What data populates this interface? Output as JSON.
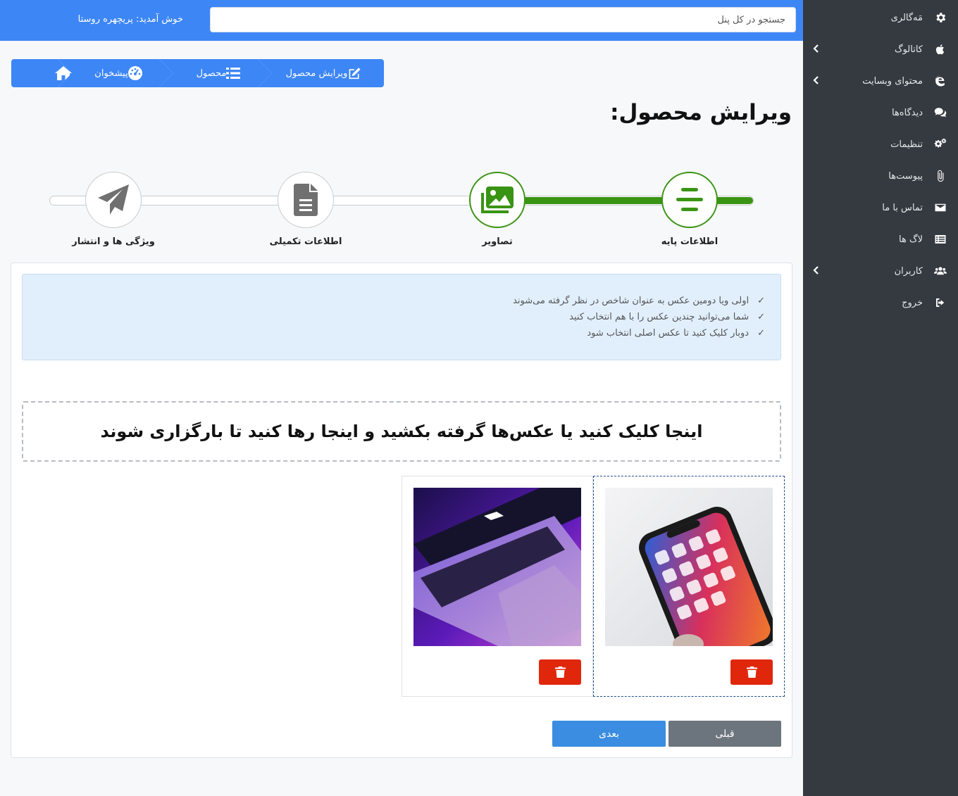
{
  "header": {
    "search_placeholder": "جستجو در کل پنل",
    "welcome": "خوش آمدید: پریچهره روستا"
  },
  "breadcrumb": {
    "items": [
      {
        "label": "ویرایش محصول",
        "icon": "edit-icon"
      },
      {
        "label": "محصول",
        "icon": "list-icon"
      },
      {
        "label": "پیشخوان",
        "icon": "dashboard-icon"
      },
      {
        "label": "",
        "icon": "home-icon"
      }
    ]
  },
  "page_title": "ویرایش محصول:",
  "stepper": {
    "steps": [
      {
        "label": "اطلاعات پایه",
        "icon": "align-center-icon",
        "done": true
      },
      {
        "label": "تصاویر",
        "icon": "images-icon",
        "done": true
      },
      {
        "label": "اطلاعات تکمیلی",
        "icon": "document-icon",
        "done": false
      },
      {
        "label": "ویژگی ها و انتشار",
        "icon": "paper-plane-icon",
        "done": false
      }
    ],
    "colors": {
      "done": "#3a9414",
      "pending": "#707070"
    }
  },
  "info": {
    "check": "✓",
    "tips": [
      "اولی ویا دومین عکس به عنوان شاخص در نظر گرفته می‌شوند",
      "شما می‌توانید چندین عکس را با هم انتخاب کنید",
      "دوبار کلیک کنید تا عکس اصلی انتخاب شود"
    ]
  },
  "dropzone": {
    "text": "اینجا کلیک کنید یا عکس‌ها گرفته بکشید و اینجا رها کنید تا بارگزاری شوند"
  },
  "images": [
    {
      "subject": "smartphone",
      "selected": true
    },
    {
      "subject": "laptop",
      "selected": false
    }
  ],
  "buttons": {
    "prev": "قبلی",
    "next": "بعدی"
  },
  "sidebar": {
    "items": [
      {
        "label": "مَه‌گالری",
        "icon": "gear-icon",
        "has_children": false
      },
      {
        "label": "کاتالوگ",
        "icon": "apple-icon",
        "has_children": true
      },
      {
        "label": "محتوای وبسایت",
        "icon": "edge-icon",
        "has_children": true
      },
      {
        "label": "دیدگاه‌ها",
        "icon": "comments-icon",
        "has_children": false
      },
      {
        "label": "تنظیمات",
        "icon": "cogs-icon",
        "has_children": false
      },
      {
        "label": "پیوست‌ها",
        "icon": "paperclip-icon",
        "has_children": false
      },
      {
        "label": "تماس با ما",
        "icon": "envelope-icon",
        "has_children": false
      },
      {
        "label": "لاگ ها",
        "icon": "list-alt-icon",
        "has_children": false
      },
      {
        "label": "کاربران",
        "icon": "users-icon",
        "has_children": true
      },
      {
        "label": "خروج",
        "icon": "sign-out-icon",
        "has_children": false
      }
    ]
  },
  "colors": {
    "primary": "#3d86f6",
    "sidebar_bg": "#343a40",
    "success": "#3a9414",
    "danger": "#e0270c",
    "info_bg": "#e1effd"
  }
}
